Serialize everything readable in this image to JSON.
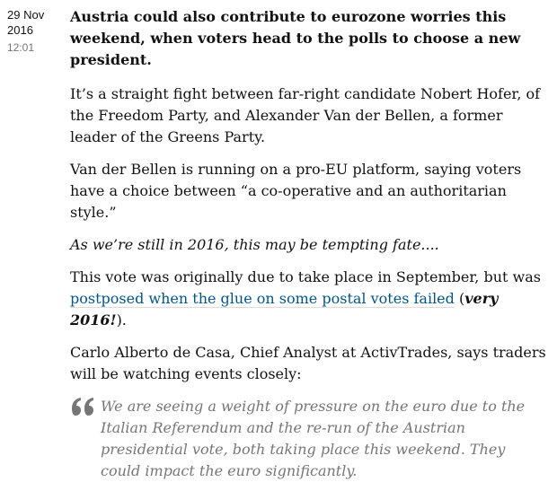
{
  "timestamp": {
    "date_line1": "29 Nov",
    "date_line2": "2016",
    "time": "12:01"
  },
  "entry": {
    "lead": "Austria could also contribute to eurozone worries this weekend, when voters head to the polls to choose a new president.",
    "para1": "It’s a straight fight between far-right candidate Nobert Hofer, of the Freedom Party, and Alexander Van der Bellen, a former leader of the Greens Party.",
    "para2": "Van der Bellen is running on a pro-EU platform, saying voters have a choice between “a co-operative and an authoritarian style.”",
    "para3": "As we’re still in 2016, this may be tempting fate....",
    "para4_before": "This vote was originally due to take place in September, but was ",
    "para4_link": "postposed when the glue on some postal votes failed",
    "para4_open": " (",
    "para4_emph": "very 2016!",
    "para4_close": ").",
    "para5": "Carlo Alberto de Casa, Chief Analyst at ActivTrades, says traders will be watching events closely:",
    "quote": "We are seeing a weight of pressure on the euro due to the Italian Referendum and the re-run of the Austrian presidential vote, both taking place this weekend. They could impact the euro significantly."
  },
  "icons": {
    "quote": "quote-icon"
  },
  "colors": {
    "link": "#005689",
    "muted": "#767676",
    "text": "#121212"
  }
}
